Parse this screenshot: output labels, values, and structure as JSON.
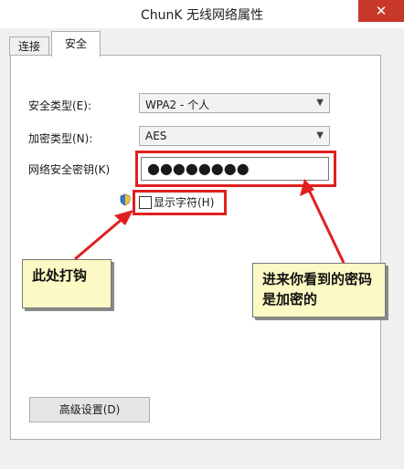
{
  "window": {
    "title": "ChunK 无线网络属性",
    "close_glyph": "✕"
  },
  "tabs": [
    {
      "label": "连接"
    },
    {
      "label": "安全"
    }
  ],
  "security_type": {
    "label": "安全类型(E):",
    "value": "WPA2 - 个人"
  },
  "encryption_type": {
    "label": "加密类型(N):",
    "value": "AES"
  },
  "network_key": {
    "label": "网络安全密钥(K)",
    "value": "●●●●●●●●"
  },
  "show_chars": {
    "label": "显示字符(H)",
    "checked": false
  },
  "advanced_button": {
    "label": "高级设置(D)"
  },
  "annotations": {
    "check_here": "此处打钩",
    "password_note": "进来你看到的密码是加密的"
  },
  "colors": {
    "highlight": "#e02020",
    "note_bg": "#fdf9c4",
    "close_bg": "#c7382a"
  },
  "icons": {
    "combo_arrow": "chevron-down-icon",
    "uac": "shield-icon"
  }
}
